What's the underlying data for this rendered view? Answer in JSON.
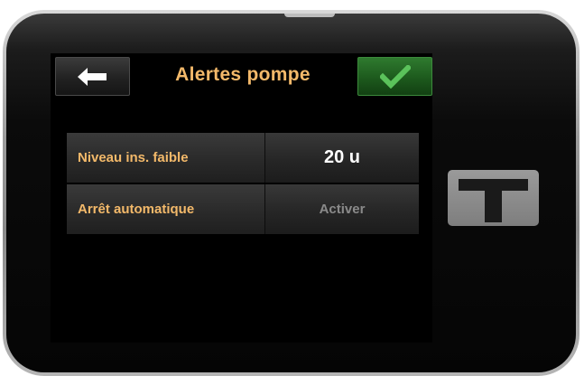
{
  "header": {
    "title": "Alertes pompe",
    "back_icon": "back-arrow-icon",
    "confirm_icon": "checkmark-icon"
  },
  "rows": [
    {
      "label": "Niveau ins. faible",
      "value": "20 u"
    },
    {
      "label": "Arrêt automatique",
      "value": "Activer"
    }
  ],
  "side_button": {
    "icon": "t-logo-icon"
  },
  "colors": {
    "label_orange": "#f3b96a",
    "confirm_green": "#2f7a2f",
    "screen_bg": "#000000"
  }
}
